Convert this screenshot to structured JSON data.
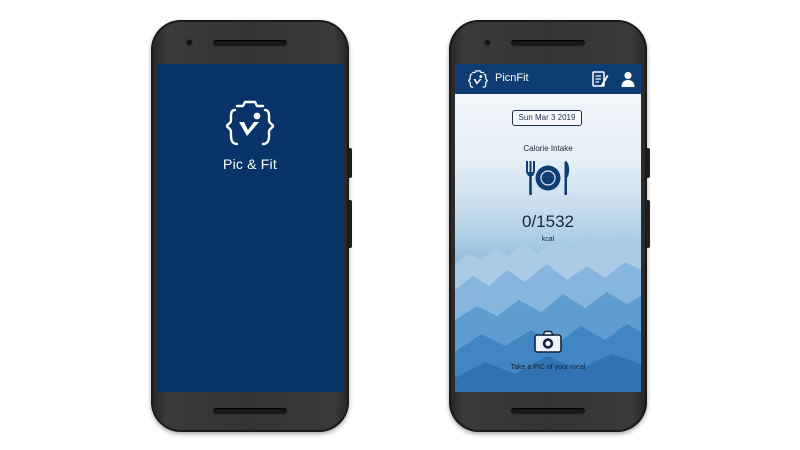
{
  "splash": {
    "app_name": "Pic & Fit",
    "logo_icon": "pic-fit-logo-icon",
    "background": "#08346a"
  },
  "app": {
    "title": "PicnFit",
    "bar_color": "#0d3d72",
    "icons": [
      "pic-fit-logo-icon",
      "edit-log-icon",
      "user-icon",
      "cutlery-icon",
      "camera-icon"
    ],
    "date": "Sun Mar 3 2019",
    "calorie_label": "Calorie Intake",
    "calories": "0/1532",
    "unit": "kcal",
    "camera_hint": "Take a PIC of your meal"
  }
}
